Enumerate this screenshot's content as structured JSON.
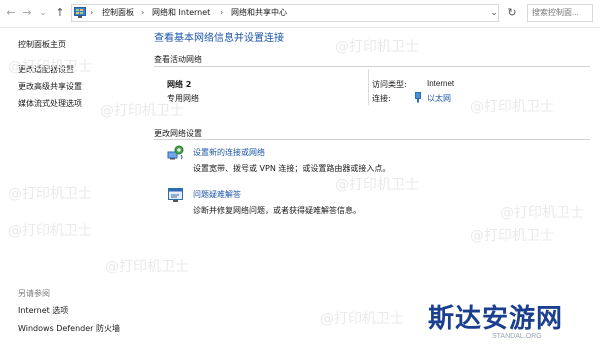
{
  "address_bar": {
    "back": "←",
    "forward": "→",
    "history": "⌄",
    "up": "↑",
    "crumbs": [
      "控制面板",
      "网络和 Internet",
      "网络和共享中心"
    ],
    "separator": "›",
    "dropdown": "⌄",
    "refresh": "↻",
    "search_placeholder": "搜索控制面..."
  },
  "sidebar": {
    "home": "控制面板主页",
    "items": [
      "更改适配器设置",
      "更改高级共享设置",
      "媒体流式处理选项"
    ],
    "see_also_label": "另请参阅",
    "see_also": [
      "Internet 选项",
      "Windows Defender 防火墙"
    ]
  },
  "main": {
    "title": "查看基本网络信息并设置连接",
    "active_networks_label": "查看活动网络",
    "network_name": "网络 2",
    "network_type": "专用网络",
    "access_type_label": "访问类型:",
    "access_type_value": "Internet",
    "connections_label": "连接:",
    "connection_value": "以太网",
    "change_settings_label": "更改网络设置",
    "tasks": [
      {
        "link": "设置新的连接或网络",
        "description": "设置宽带、拨号或 VPN 连接；或设置路由器或接入点。",
        "icon": "network-setup-icon"
      },
      {
        "link": "问题疑难解答",
        "description": "诊断并修复网络问题，或者获得疑难解答信息。",
        "icon": "troubleshoot-icon"
      }
    ]
  },
  "watermark_text": "@打印机卫士",
  "brand": {
    "name": "斯达安游网",
    "url": "STANDAL.ORG"
  },
  "colors": {
    "link": "#1c55a8",
    "brand": "#1b3f8f"
  }
}
